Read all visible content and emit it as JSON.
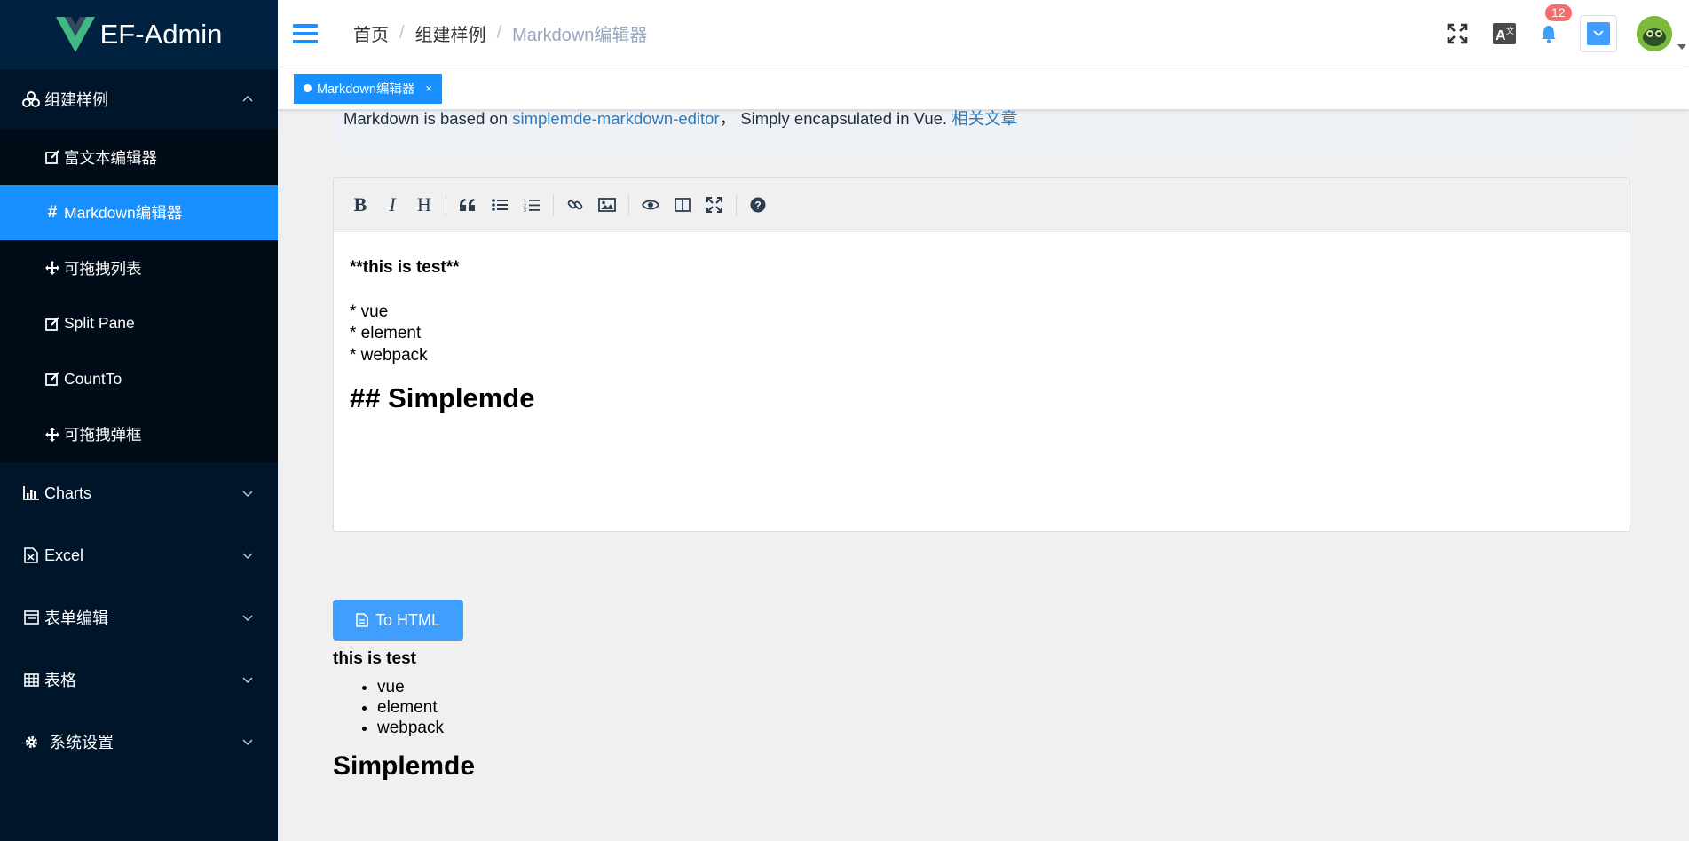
{
  "app": {
    "logo_text": "EF-Admin",
    "accent": "#1890ff",
    "sidebar_bg": "#001529"
  },
  "sidebar": {
    "groups": [
      {
        "label": "组建样例",
        "icon": "cubes-icon",
        "expanded": true,
        "items": [
          {
            "label": "富文本编辑器",
            "icon": "edit-icon"
          },
          {
            "label": "Markdown编辑器",
            "icon": "hash-icon",
            "active": true
          },
          {
            "label": "可拖拽列表",
            "icon": "move-icon"
          },
          {
            "label": "Split Pane",
            "icon": "edit-icon"
          },
          {
            "label": "CountTo",
            "icon": "edit-icon"
          },
          {
            "label": "可拖拽弹框",
            "icon": "move-icon"
          }
        ]
      },
      {
        "label": "Charts",
        "icon": "bar-chart-icon"
      },
      {
        "label": "Excel",
        "icon": "excel-file-icon"
      },
      {
        "label": "表单编辑",
        "icon": "form-icon"
      },
      {
        "label": "表格",
        "icon": "table-icon"
      },
      {
        "label": "系统设置",
        "icon": "gear-icon"
      }
    ]
  },
  "header": {
    "breadcrumb": [
      "首页",
      "组建样例",
      "Markdown编辑器"
    ],
    "separator": "/",
    "notification_count": "12"
  },
  "tags": [
    {
      "label": "Markdown编辑器",
      "close": "×",
      "active": true
    }
  ],
  "intro": {
    "prefix": "Markdown is based on ",
    "link1": "simplemde-markdown-editor",
    "middle": "，  Simply encapsulated in Vue. ",
    "link2": "相关文章"
  },
  "editor": {
    "toolbar": [
      "bold",
      "italic",
      "heading",
      "|",
      "quote",
      "unordered-list",
      "ordered-list",
      "|",
      "link",
      "image",
      "|",
      "preview",
      "side-by-side",
      "fullscreen",
      "|",
      "guide"
    ],
    "lines": {
      "bold": "**this is test**",
      "l1": "* vue",
      "l2": "* element",
      "l3": "* webpack",
      "h2": "## Simplemde"
    }
  },
  "to_html_label": "To HTML",
  "preview": {
    "title": "this is test",
    "items": [
      "vue",
      "element",
      "webpack"
    ],
    "h2": "Simplemde"
  }
}
